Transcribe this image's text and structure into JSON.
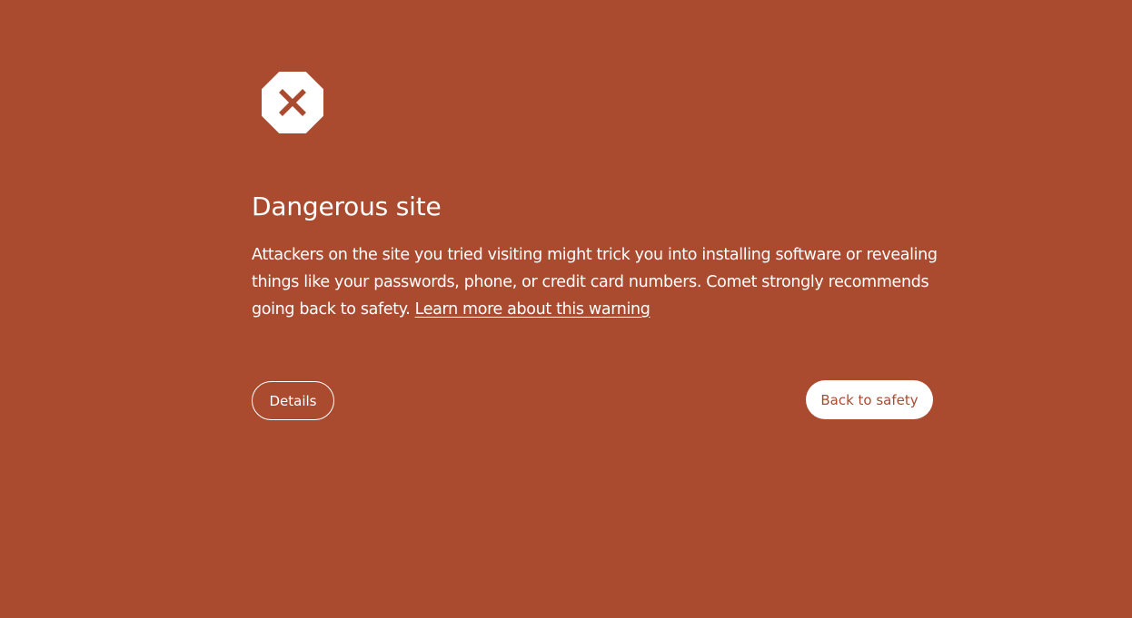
{
  "page": {
    "background_color": "#AA4B30",
    "icon": "stop-sign-error-icon"
  },
  "main": {
    "heading": "Dangerous site",
    "message": "Attackers on the site you tried visiting might trick you into installing software or revealing things like your passwords, phone, or credit card numbers. Comet strongly recommends going back to safety.",
    "learn_more_link": "Learn more about this warning"
  },
  "buttons": {
    "details_label": "Details",
    "back_label": "Back to safety"
  }
}
